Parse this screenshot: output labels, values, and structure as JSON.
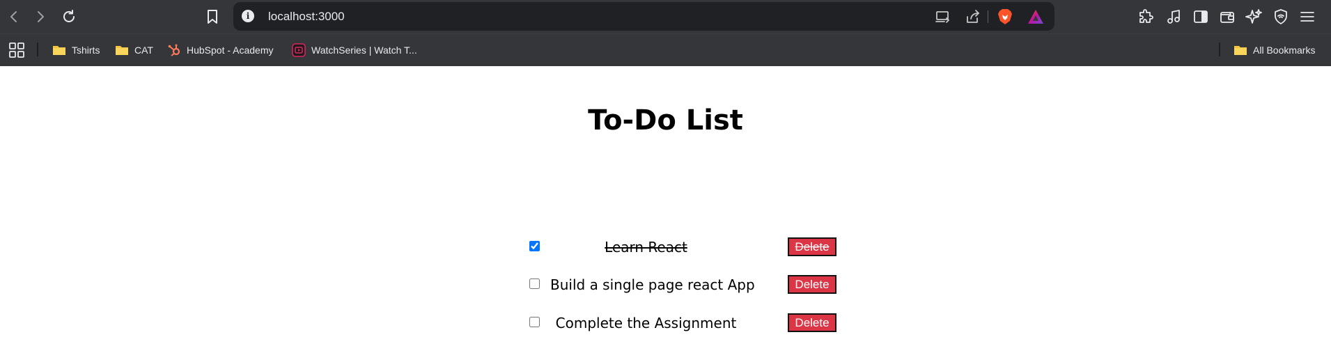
{
  "browser": {
    "url": "localhost:3000",
    "bookmarks": [
      {
        "label": "Tshirts",
        "icon": "folder-icon"
      },
      {
        "label": "CAT",
        "icon": "folder-icon"
      },
      {
        "label": "HubSpot - Academy",
        "icon": "hubspot-icon"
      },
      {
        "label": "WatchSeries | Watch T...",
        "icon": "watchseries-icon"
      }
    ],
    "all_bookmarks_label": "All Bookmarks"
  },
  "app": {
    "title": "To-Do List",
    "delete_label": "Delete",
    "todos": [
      {
        "text": "Learn React",
        "completed": true
      },
      {
        "text": "Build a single page react App",
        "completed": false
      },
      {
        "text": "Complete the Assignment",
        "completed": false
      }
    ]
  },
  "colors": {
    "browser_chrome": "#35363a",
    "urlbar": "#202124",
    "delete_button": "#dc3545",
    "checkbox_accent": "#0075ff"
  }
}
